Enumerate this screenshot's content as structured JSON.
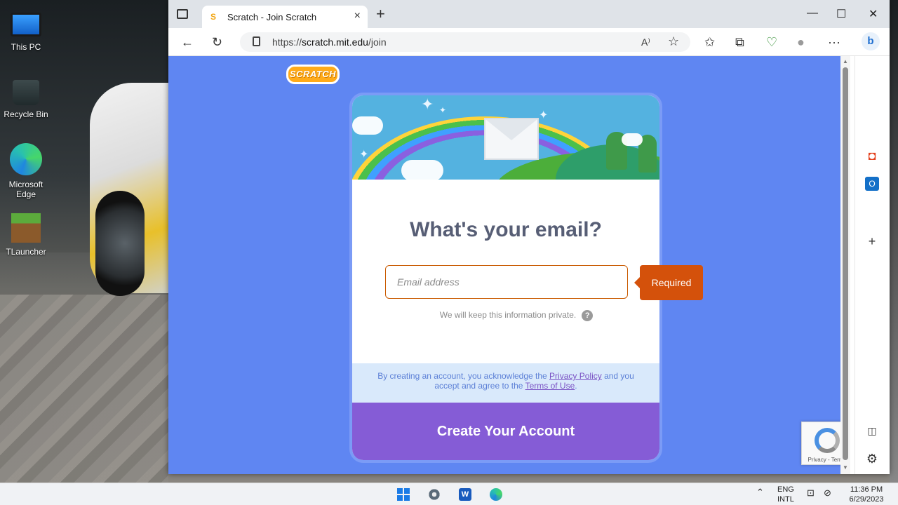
{
  "desktop": {
    "icons": [
      {
        "label": "This PC"
      },
      {
        "label": "Recycle Bin"
      },
      {
        "label": "Microsoft Edge"
      },
      {
        "label": "TLauncher"
      }
    ]
  },
  "browser": {
    "tab": {
      "title": "Scratch - Join Scratch",
      "favicon": "S"
    },
    "address": {
      "prefix": "https://",
      "host": "scratch.mit.edu",
      "path": "/join"
    },
    "window_controls": {
      "minimize": "—",
      "maximize": "☐",
      "close": "✕"
    },
    "toolbar_icons": {
      "back": "←",
      "refresh": "↻",
      "read_aloud": "A⁾",
      "favorite": "☆",
      "favorites": "✩",
      "collections": "⧉",
      "health": "♡",
      "profile": "●",
      "more": "···"
    }
  },
  "page": {
    "logo": "SCRATCH",
    "heading": "What's your email?",
    "email_placeholder": "Email address",
    "email_value": "",
    "hint": "We will keep this information private.",
    "help_icon": "?",
    "required_tooltip": "Required",
    "legal": {
      "before": "By creating an account, you acknowledge the ",
      "privacy_link": "Privacy Policy",
      "middle": " and you accept and agree to the ",
      "terms_link": "Terms of Use",
      "after": "."
    },
    "submit_button": "Create Your Account",
    "recaptcha_text": "Privacy - Terms"
  },
  "taskbar": {
    "tray": {
      "language_line1": "ENG",
      "language_line2": "INTL"
    },
    "clock": {
      "time": "11:36 PM",
      "date": "6/29/2023"
    }
  },
  "colors": {
    "page_background": "#5f86f2",
    "submit_button": "#855cd6",
    "required_tooltip": "#d4510b",
    "legal_background": "#d9e9fb"
  }
}
